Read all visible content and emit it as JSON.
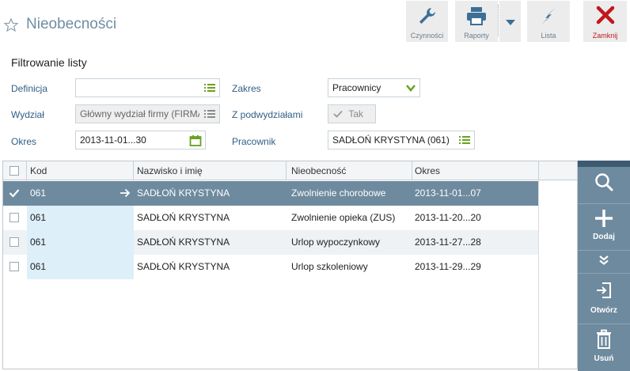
{
  "header": {
    "title": "Nieobecności",
    "buttons": {
      "czynnosci": "Czynności",
      "raporty": "Raporty",
      "lista": "Lista",
      "zamknij": "Zamknij"
    }
  },
  "filter": {
    "title": "Filtrowanie listy",
    "definicja_label": "Definicja",
    "definicja_value": "",
    "zakres_label": "Zakres",
    "zakres_value": "Pracownicy",
    "wydzial_label": "Wydział",
    "wydzial_value": "Główny wydział firmy (FIRMA)",
    "podwydzialy_label": "Z podwydziałami",
    "podwydzialy_value": "Tak",
    "okres_label": "Okres",
    "okres_value": "2013-11-01...30",
    "pracownik_label": "Pracownik",
    "pracownik_value": "SADŁOŃ KRYSTYNA (061)"
  },
  "table": {
    "columns": [
      "Kod",
      "Nazwisko i imię",
      "Nieobecność",
      "Okres"
    ],
    "rows": [
      {
        "kod": "061",
        "nazwisko": "SADŁOŃ KRYSTYNA",
        "nieobecnosc": "Zwolnienie chorobowe",
        "okres": "2013-11-01...07"
      },
      {
        "kod": "061",
        "nazwisko": "SADŁOŃ KRYSTYNA",
        "nieobecnosc": "Zwolnienie opieka (ZUS)",
        "okres": "2013-11-20...20"
      },
      {
        "kod": "061",
        "nazwisko": "SADŁOŃ KRYSTYNA",
        "nieobecnosc": "Urlop wypoczynkowy",
        "okres": "2013-11-27...28"
      },
      {
        "kod": "061",
        "nazwisko": "SADŁOŃ KRYSTYNA",
        "nieobecnosc": "Urlop szkoleniowy",
        "okres": "2013-11-29...29"
      }
    ]
  },
  "side": {
    "dodaj": "Dodaj",
    "otworz": "Otwórz",
    "usun": "Usuń"
  },
  "colors": {
    "accent": "#6e8a9e",
    "green_icon": "#6aa121",
    "close_red": "#c0181d"
  }
}
